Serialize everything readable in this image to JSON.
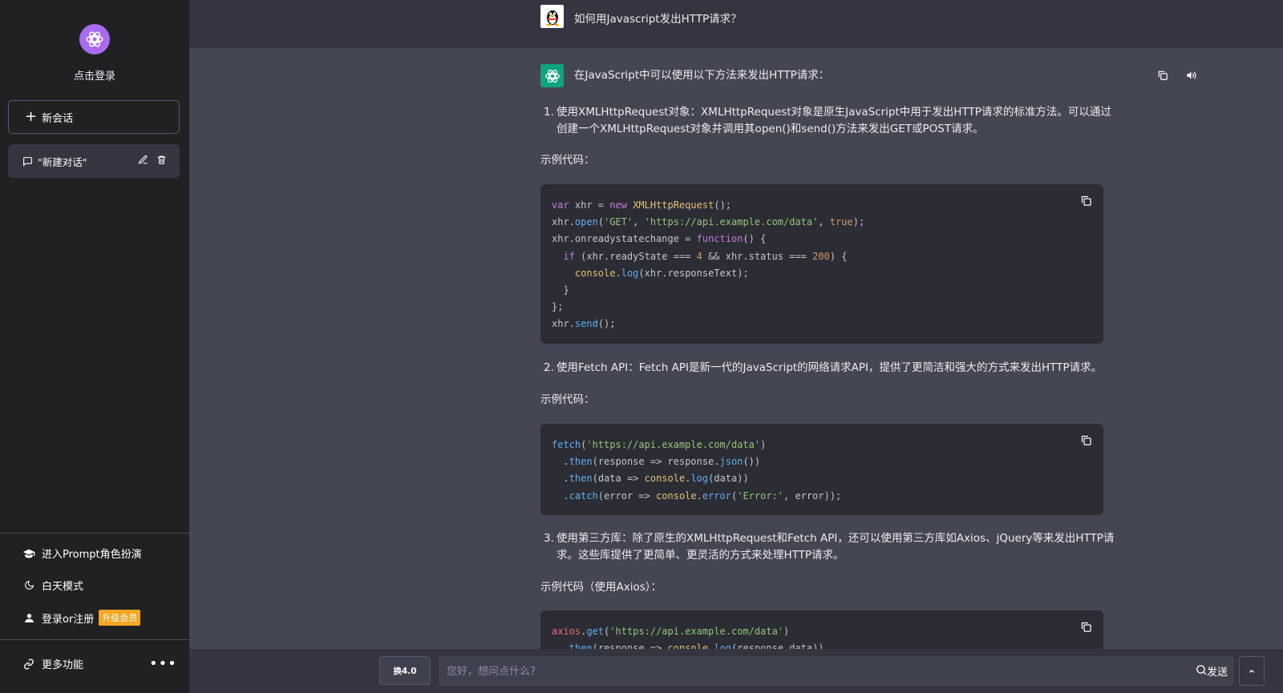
{
  "sidebar": {
    "login_title": "点击登录",
    "new_chat_label": "新会话",
    "conversation": {
      "title": "\"新建对话\""
    },
    "menu": {
      "prompt": "进入Prompt角色扮演",
      "theme": "白天模式",
      "login": "登录or注册",
      "vip_badge": "升级会员",
      "more": "更多功能"
    },
    "icons": [
      "openai-logo-icon",
      "plus-icon",
      "chat-icon",
      "edit-icon",
      "trash-icon",
      "graduation-cap-icon",
      "moon-icon",
      "user-icon",
      "link-icon",
      "more-dots-icon"
    ]
  },
  "chat": {
    "user_message": "如何用Javascript发出HTTP请求？",
    "answer": {
      "intro": "在JavaScript中可以使用以下方法来发出HTTP请求：",
      "items": [
        {
          "num": "1.",
          "text": "使用XMLHttpRequest对象：XMLHttpRequest对象是原生JavaScript中用于发出HTTP请求的标准方法。可以通过创建一个XMLHttpRequest对象并调用其open()和send()方法来发出GET或POST请求。",
          "example_label": "示例代码："
        },
        {
          "num": "2.",
          "text": "使用Fetch API：Fetch API是新一代的JavaScript的网络请求API，提供了更简洁和强大的方式来发出HTTP请求。",
          "example_label": "示例代码："
        },
        {
          "num": "3.",
          "text": "使用第三方库：除了原生的XMLHttpRequest和Fetch API，还可以使用第三方库如Axios、jQuery等来发出HTTP请求。这些库提供了更简单、更灵活的方式来处理HTTP请求。",
          "example_label": "示例代码（使用Axios）："
        }
      ]
    },
    "icons": [
      "qq-penguin-avatar-icon",
      "chatgpt-avatar-icon",
      "copy-icon",
      "speaker-icon",
      "code-copy-icon"
    ]
  },
  "input": {
    "model_label": "换4.0",
    "placeholder": "您好，想问点什么?",
    "send_label": "发送",
    "icons": [
      "send-icon",
      "chevron-up-icon"
    ]
  },
  "colors": {
    "sidebar_bg": "#202123",
    "main_bg": "#444654",
    "code_bg": "#2b2c34",
    "accent_purple": "#a96bf0",
    "bot_green": "#10a37f",
    "badge_orange": "#f5a623"
  }
}
